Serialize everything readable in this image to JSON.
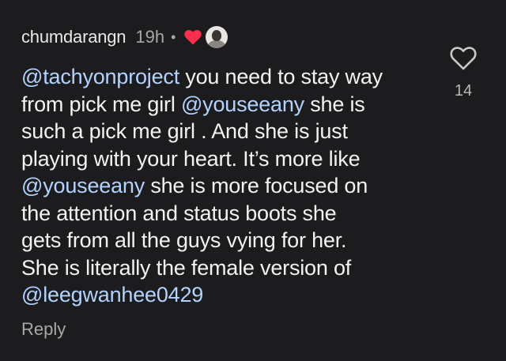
{
  "comment": {
    "username": "chumdarangn",
    "time": "19h",
    "separator": "•",
    "liked_by_author_icon": "red-heart-icon",
    "author_avatar_icon": "avatar-icon",
    "lines": [
      [
        {
          "text": "@tachyonproject",
          "mention": true
        },
        {
          "text": " you need to stay way"
        }
      ],
      [
        {
          "text": "from pick me girl "
        },
        {
          "text": "@youseeany",
          "mention": true
        },
        {
          "text": " she is"
        }
      ],
      [
        {
          "text": "such a pick me girl . And she is just"
        }
      ],
      [
        {
          "text": "playing with your heart. It’s more like"
        }
      ],
      [
        {
          "text": "@youseeany",
          "mention": true
        },
        {
          "text": " she is more focused on"
        }
      ],
      [
        {
          "text": "the attention and status boots she"
        }
      ],
      [
        {
          "text": "gets from all the guys vying for her."
        }
      ],
      [
        {
          "text": "She is literally the female version of"
        }
      ],
      [
        {
          "text": "@leegwanhee0429",
          "mention": true
        }
      ]
    ],
    "reply_label": "Reply",
    "like_icon": "heart-outline-icon",
    "like_count": "14"
  },
  "colors": {
    "background": "#1c1c1e",
    "text": "#f3f3f3",
    "secondary_text": "#a8a8a8",
    "mention": "#b3d3ff",
    "heart": "#ff2e4d"
  }
}
